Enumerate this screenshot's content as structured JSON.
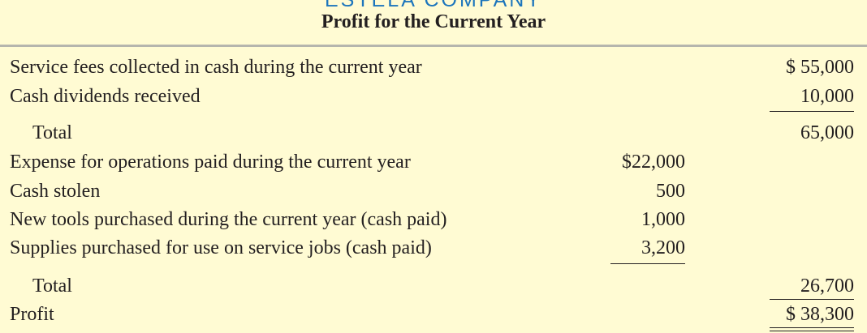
{
  "header": {
    "company": "ESTELA COMPANY",
    "title": "Profit for the Current Year"
  },
  "rows": [
    {
      "label": "Service fees collected in cash during the current year",
      "col1": "",
      "col2": "$ 55,000"
    },
    {
      "label": "Cash dividends received",
      "col1": "",
      "col2": "10,000"
    },
    {
      "label": "Total",
      "col1": "",
      "col2": "65,000"
    },
    {
      "label": "Expense for operations paid during the current year",
      "col1": "$22,000",
      "col2": ""
    },
    {
      "label": "Cash stolen",
      "col1": "500",
      "col2": ""
    },
    {
      "label": "New tools purchased during the current year (cash paid)",
      "col1": "1,000",
      "col2": ""
    },
    {
      "label": "Supplies purchased for use on service jobs (cash paid)",
      "col1": "3,200",
      "col2": ""
    },
    {
      "label": "Total",
      "col1": "",
      "col2": "26,700"
    },
    {
      "label": "Profit",
      "col1": "",
      "col2": "$ 38,300"
    }
  ],
  "colors": {
    "background": "#fffbd3",
    "company_text": "#1c75bc",
    "rule": "#b5b5ad",
    "text": "#231f20"
  }
}
